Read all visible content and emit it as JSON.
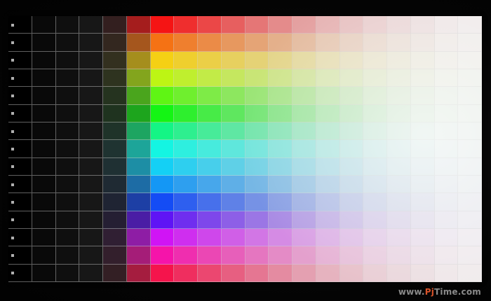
{
  "image": {
    "subject": "color-patch-grid",
    "grid": {
      "columns": 20,
      "rows": 15,
      "gray_column_levels": [
        0,
        0.035,
        0.06,
        0.09,
        0.16
      ],
      "hue_rows_deg": [
        0,
        25,
        50,
        75,
        100,
        120,
        150,
        175,
        190,
        205,
        225,
        260,
        290,
        320,
        345
      ],
      "dark_to_full_column": 5,
      "lightness_columns": [
        52,
        56,
        60,
        64,
        68,
        72,
        76,
        80,
        83,
        86,
        88,
        90,
        92,
        93,
        94
      ]
    },
    "colors": {
      "screen_background": "#000000",
      "photo_surround": "#050505",
      "gridline": "rgba(210,210,210,0.45)",
      "highlight": "#ffffff"
    }
  },
  "watermark": {
    "prefix": "www.",
    "brand_a": "Pj",
    "brand_b": "Time",
    "suffix": ".com"
  }
}
